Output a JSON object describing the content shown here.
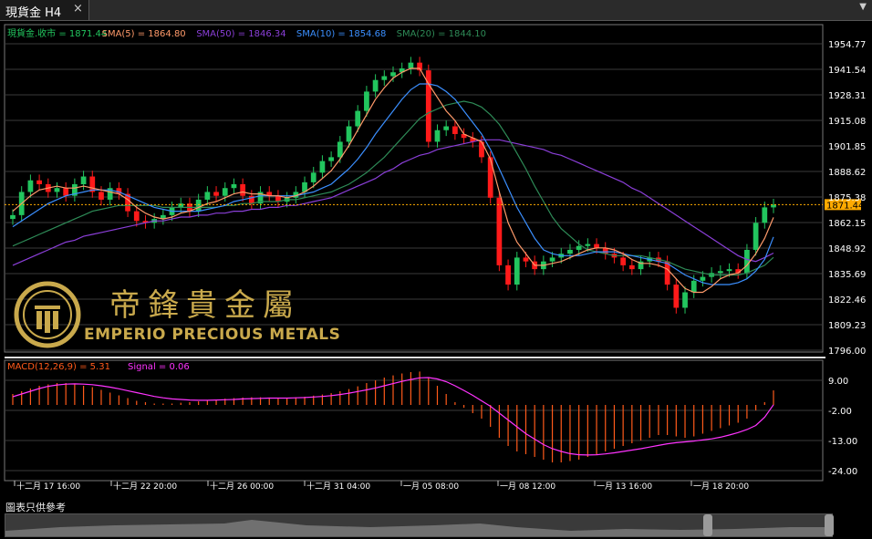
{
  "window": {
    "title": "現貨金 H4",
    "close_icon": "×",
    "menu_icon": "▼"
  },
  "colors": {
    "background": "#000000",
    "grid": "#3a3a3a",
    "axis_text": "#ffffff",
    "up_candle": "#22c55e",
    "down_candle": "#ff1a1a",
    "sma5": "#ff9a6a",
    "sma10": "#3b8fff",
    "sma20": "#2e8b57",
    "sma50": "#8b3fd9",
    "current_price_line": "#ffaa00",
    "macd_hist": "#ff5a1a",
    "signal": "#ff33ff"
  },
  "legend_main": [
    {
      "text": "現貨金.收市 = 1871.44",
      "color": "#22c55e"
    },
    {
      "text": "SMA(5) = 1864.80",
      "color": "#ff9a6a"
    },
    {
      "text": "SMA(50) = 1846.34",
      "color": "#8b3fd9"
    },
    {
      "text": "SMA(10) = 1854.68",
      "color": "#3b8fff"
    },
    {
      "text": "SMA(20) = 1844.10",
      "color": "#2e8b57"
    }
  ],
  "legend_macd": [
    {
      "text": "MACD(12,26,9) = 5.31",
      "color": "#ff5a1a"
    },
    {
      "text": "Signal = 0.06",
      "color": "#ff33ff"
    }
  ],
  "logo": {
    "chinese": "帝鋒貴金屬",
    "english": "EMPERIO PRECIOUS METALS"
  },
  "disclaimer": "圖表只供參考",
  "chart_data": {
    "type": "line",
    "main_y_ticks": [
      "1954.77",
      "1941.54",
      "1928.31",
      "1915.08",
      "1901.85",
      "1888.62",
      "1875.38",
      "1862.15",
      "1848.92",
      "1835.69",
      "1822.46",
      "1809.23",
      "1796.00"
    ],
    "main_ylim": [
      1796.0,
      1954.77
    ],
    "current_price_label": "1871.44",
    "current_price": 1871.44,
    "macd_y_ticks": [
      "9.00",
      "-2.00",
      "-13.00",
      "-24.00"
    ],
    "macd_ylim": [
      -24.0,
      9.0
    ],
    "x_tick_labels": [
      "十二月 17 16:00",
      "十二月 22 20:00",
      "十二月 26 00:00",
      "十二月 31 04:00",
      "一月 05 08:00",
      "一月 08 12:00",
      "一月 13 16:00",
      "一月 18 20:00"
    ],
    "close": [
      1866,
      1878,
      1884,
      1882,
      1878,
      1880,
      1876,
      1882,
      1886,
      1878,
      1874,
      1880,
      1877,
      1868,
      1863,
      1862,
      1864,
      1866,
      1870,
      1872,
      1868,
      1874,
      1878,
      1876,
      1880,
      1882,
      1876,
      1872,
      1878,
      1876,
      1873,
      1875,
      1878,
      1883,
      1888,
      1894,
      1896,
      1904,
      1912,
      1920,
      1930,
      1936,
      1938,
      1940,
      1942,
      1945,
      1941,
      1904,
      1910,
      1912,
      1908,
      1906,
      1904,
      1896,
      1875,
      1840,
      1830,
      1844,
      1842,
      1838,
      1842,
      1844,
      1846,
      1848,
      1850,
      1851,
      1849,
      1846,
      1844,
      1840,
      1838,
      1842,
      1844,
      1842,
      1830,
      1818,
      1826,
      1832,
      1834,
      1836,
      1837,
      1838,
      1836,
      1848,
      1862,
      1870,
      1871.44
    ],
    "sma5": [
      1868,
      1872,
      1876,
      1879,
      1880,
      1881,
      1880,
      1880,
      1881,
      1880,
      1879,
      1878,
      1877,
      1874,
      1870,
      1867,
      1865,
      1864,
      1865,
      1867,
      1868,
      1870,
      1872,
      1873,
      1875,
      1877,
      1878,
      1877,
      1877,
      1876,
      1876,
      1875,
      1876,
      1878,
      1881,
      1885,
      1889,
      1895,
      1902,
      1910,
      1918,
      1926,
      1932,
      1937,
      1940,
      1942,
      1942,
      1934,
      1927,
      1920,
      1915,
      1908,
      1906,
      1904,
      1895,
      1878,
      1862,
      1852,
      1846,
      1840,
      1840,
      1841,
      1842,
      1844,
      1846,
      1848,
      1849,
      1849,
      1848,
      1846,
      1843,
      1841,
      1841,
      1840,
      1838,
      1833,
      1828,
      1826,
      1826,
      1829,
      1833,
      1835,
      1836,
      1840,
      1846,
      1854,
      1864.8
    ],
    "sma10": [
      1860,
      1863,
      1866,
      1869,
      1872,
      1874,
      1876,
      1877,
      1878,
      1879,
      1879,
      1879,
      1878,
      1876,
      1874,
      1872,
      1870,
      1869,
      1868,
      1868,
      1868,
      1868,
      1869,
      1870,
      1871,
      1873,
      1874,
      1875,
      1876,
      1876,
      1876,
      1876,
      1876,
      1877,
      1878,
      1880,
      1882,
      1886,
      1890,
      1895,
      1901,
      1908,
      1914,
      1920,
      1926,
      1931,
      1934,
      1934,
      1933,
      1930,
      1926,
      1920,
      1914,
      1908,
      1900,
      1890,
      1880,
      1870,
      1862,
      1854,
      1848,
      1846,
      1845,
      1845,
      1845,
      1846,
      1847,
      1847,
      1847,
      1846,
      1845,
      1844,
      1843,
      1842,
      1841,
      1838,
      1835,
      1833,
      1831,
      1830,
      1830,
      1830,
      1831,
      1833,
      1837,
      1843,
      1854.68
    ],
    "sma20": [
      1850,
      1852,
      1854,
      1856,
      1858,
      1860,
      1862,
      1864,
      1866,
      1868,
      1869,
      1870,
      1871,
      1871,
      1871,
      1871,
      1871,
      1870,
      1870,
      1870,
      1870,
      1870,
      1870,
      1870,
      1871,
      1871,
      1872,
      1872,
      1873,
      1873,
      1873,
      1874,
      1874,
      1875,
      1876,
      1877,
      1878,
      1880,
      1882,
      1885,
      1888,
      1892,
      1896,
      1901,
      1906,
      1911,
      1916,
      1919,
      1921,
      1923,
      1924,
      1925,
      1924,
      1922,
      1918,
      1913,
      1906,
      1898,
      1890,
      1881,
      1873,
      1865,
      1859,
      1855,
      1851,
      1848,
      1847,
      1846,
      1845,
      1845,
      1845,
      1845,
      1844,
      1843,
      1842,
      1840,
      1838,
      1837,
      1836,
      1835,
      1835,
      1835,
      1835,
      1836,
      1838,
      1840,
      1844.1
    ],
    "sma50": [
      1840,
      1842,
      1844,
      1846,
      1848,
      1850,
      1852,
      1853,
      1855,
      1856,
      1857,
      1858,
      1859,
      1860,
      1861,
      1862,
      1863,
      1863,
      1864,
      1865,
      1865,
      1866,
      1866,
      1867,
      1867,
      1868,
      1868,
      1869,
      1869,
      1870,
      1870,
      1871,
      1871,
      1872,
      1873,
      1874,
      1875,
      1877,
      1879,
      1881,
      1883,
      1885,
      1888,
      1890,
      1893,
      1895,
      1897,
      1898,
      1900,
      1901,
      1902,
      1903,
      1904,
      1905,
      1905,
      1905,
      1904,
      1903,
      1902,
      1901,
      1900,
      1898,
      1897,
      1895,
      1893,
      1891,
      1889,
      1887,
      1885,
      1883,
      1880,
      1878,
      1875,
      1872,
      1869,
      1866,
      1863,
      1860,
      1857,
      1854,
      1851,
      1848,
      1845,
      1843,
      1842,
      1844,
      1846.34
    ],
    "macd": [
      4,
      5,
      6,
      7,
      7.5,
      8,
      8,
      7.5,
      7,
      6.5,
      5.5,
      4.5,
      3.5,
      2.5,
      1.5,
      1,
      0.5,
      0.5,
      0.5,
      0.8,
      1,
      1.3,
      1.6,
      2,
      2.3,
      2.5,
      2.7,
      2.8,
      2.8,
      2.7,
      2.6,
      2.6,
      2.8,
      3,
      3.4,
      3.8,
      4.3,
      5,
      5.8,
      6.8,
      8,
      9,
      10,
      10.8,
      11.5,
      12,
      12.2,
      10,
      7,
      4,
      1,
      -1,
      -3,
      -5,
      -8,
      -12,
      -15,
      -17,
      -18,
      -19,
      -20,
      -21,
      -21,
      -20.5,
      -20,
      -19,
      -18,
      -17,
      -16,
      -15,
      -14,
      -13,
      -12,
      -11,
      -11,
      -11.5,
      -12,
      -11.5,
      -10.5,
      -9.5,
      -8.5,
      -7.5,
      -6.5,
      -5,
      -2,
      1,
      5.31
    ],
    "signal": [
      3,
      4,
      5,
      6,
      6.8,
      7.3,
      7.6,
      7.7,
      7.6,
      7.4,
      7,
      6.5,
      5.9,
      5.2,
      4.5,
      3.8,
      3.1,
      2.6,
      2.2,
      2,
      1.8,
      1.7,
      1.7,
      1.8,
      1.9,
      2,
      2.2,
      2.3,
      2.4,
      2.5,
      2.5,
      2.5,
      2.6,
      2.7,
      2.9,
      3.1,
      3.4,
      3.8,
      4.3,
      4.9,
      5.5,
      6.2,
      7,
      7.8,
      8.6,
      9.3,
      9.9,
      10,
      9.5,
      8.5,
      7,
      5.3,
      3.5,
      1.5,
      -0.5,
      -3,
      -5.5,
      -8,
      -10.5,
      -12.5,
      -14.5,
      -16,
      -17,
      -17.8,
      -18.2,
      -18.3,
      -18.2,
      -17.9,
      -17.5,
      -17,
      -16.5,
      -16,
      -15.4,
      -14.8,
      -14.2,
      -13.8,
      -13.5,
      -13.2,
      -12.8,
      -12.4,
      -11.8,
      -11,
      -10.1,
      -9,
      -7.5,
      -4.5,
      0.06
    ]
  }
}
